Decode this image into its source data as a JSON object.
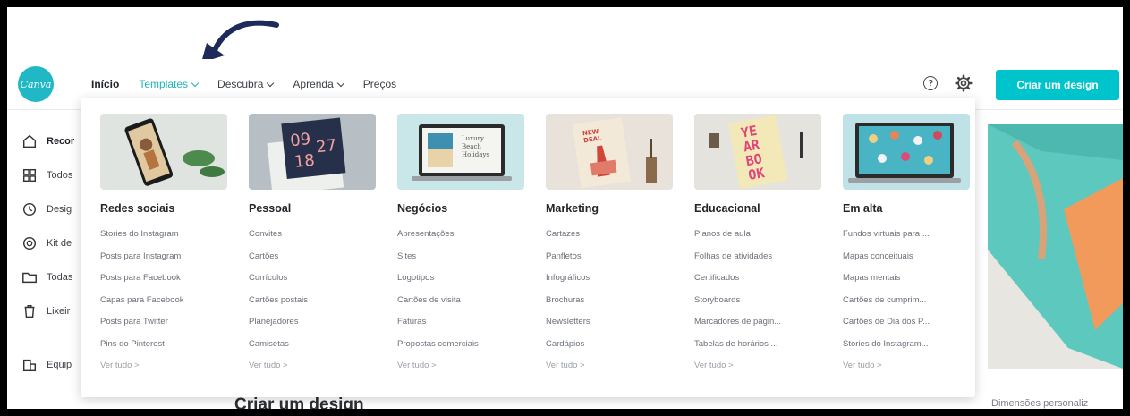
{
  "logo": {
    "text": "Canva"
  },
  "nav": {
    "items": [
      {
        "label": "Início",
        "state": "active"
      },
      {
        "label": "Templates",
        "state": "open",
        "dropdown": true
      },
      {
        "label": "Descubra",
        "dropdown": true
      },
      {
        "label": "Aprenda",
        "dropdown": true
      },
      {
        "label": "Preços"
      }
    ]
  },
  "header": {
    "help_icon": "?",
    "create_button": "Criar um design"
  },
  "sidebar": {
    "items": [
      {
        "label": "Recor",
        "icon": "home-icon"
      },
      {
        "label": "Todos",
        "icon": "grid-icon"
      },
      {
        "label": "Desig",
        "icon": "clock-icon"
      },
      {
        "label": "Kit de",
        "icon": "brand-kit-icon"
      },
      {
        "label": "Todas",
        "icon": "folder-icon"
      },
      {
        "label": "Lixeir",
        "icon": "trash-icon"
      },
      {
        "label": "Equip",
        "icon": "team-icon"
      }
    ]
  },
  "dropdown": {
    "columns": [
      {
        "title": "Redes sociais",
        "items": [
          "Stories do Instagram",
          "Posts para Instagram",
          "Posts para Facebook",
          "Capas para Facebook",
          "Posts para Twitter",
          "Pins do Pinterest"
        ],
        "see_all": "Ver tudo >"
      },
      {
        "title": "Pessoal",
        "items": [
          "Convites",
          "Cartões",
          "Currículos",
          "Cartões postais",
          "Planejadores",
          "Camisetas"
        ],
        "see_all": "Ver tudo >"
      },
      {
        "title": "Negócios",
        "items": [
          "Apresentações",
          "Sites",
          "Logotipos",
          "Cartões de visita",
          "Faturas",
          "Propostas comerciais"
        ],
        "see_all": "Ver tudo >"
      },
      {
        "title": "Marketing",
        "items": [
          "Cartazes",
          "Panfletos",
          "Infográficos",
          "Brochuras",
          "Newsletters",
          "Cardápios"
        ],
        "see_all": "Ver tudo >"
      },
      {
        "title": "Educacional",
        "items": [
          "Planos de aula",
          "Folhas de atividades",
          "Certificados",
          "Storyboards",
          "Marcadores de págin...",
          "Tabelas de horários ..."
        ],
        "see_all": "Ver tudo >"
      },
      {
        "title": "Em alta",
        "items": [
          "Fundos virtuais para ...",
          "Mapas conceituais",
          "Mapas mentais",
          "Cartões de cumprim...",
          "Cartões de Dia dos P...",
          "Stories do Instagram..."
        ],
        "see_all": "Ver tudo >"
      }
    ],
    "thumb_text": {
      "pessoal": [
        "09",
        "27",
        "18"
      ],
      "negocios": [
        "Luxury",
        "Beach",
        "Holidays"
      ],
      "marketing": [
        "NEW",
        "DEAL"
      ],
      "educacional": [
        "YE",
        "AR",
        "BO",
        "OK"
      ]
    }
  },
  "main": {
    "create_title": "Criar um design",
    "custom_dimensions": "Dimensões personaliz"
  },
  "colors": {
    "accent": "#00c4cc",
    "nav_active_teal": "#1fb3b9",
    "arrow": "#1d2a5a"
  }
}
